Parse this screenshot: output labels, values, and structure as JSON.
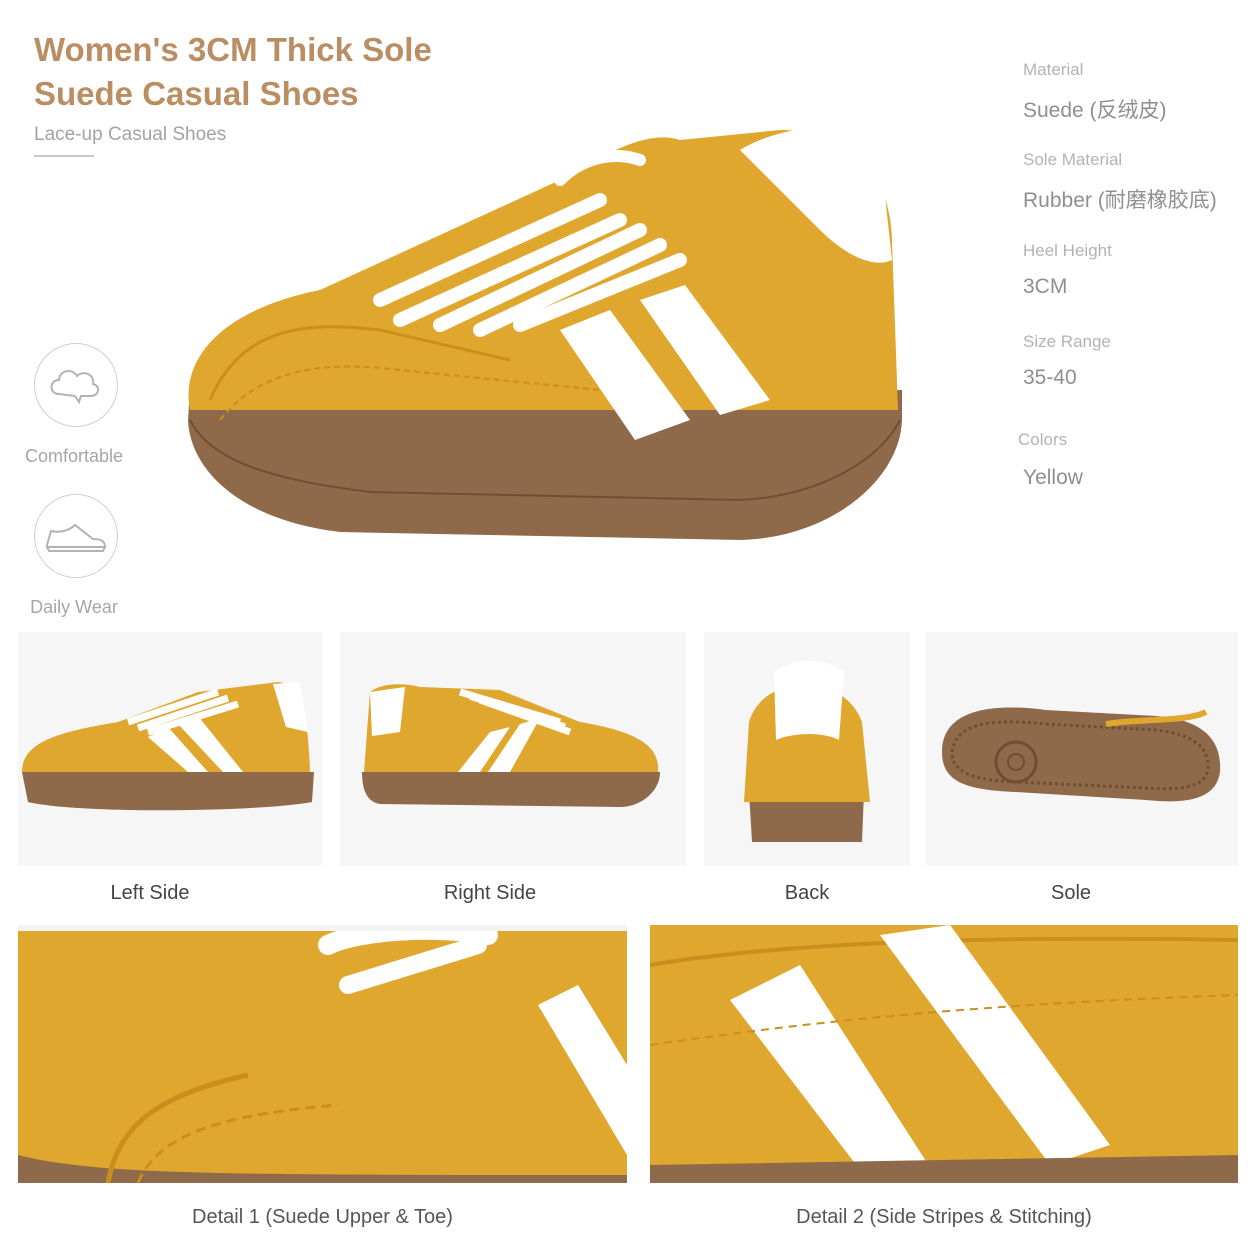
{
  "header": {
    "title_line1": "Women's 3CM Thick Sole",
    "title_line2": "Suede Casual Shoes",
    "subtitle": "Lace-up Casual Shoes"
  },
  "specs": [
    {
      "label": "Material",
      "value": "Suede (反绒皮)"
    },
    {
      "label": "Sole Material",
      "value": "Rubber (耐磨橡胶底)"
    },
    {
      "label": "Heel Height",
      "value": "3CM"
    },
    {
      "label": "Size Range",
      "value": "35-40"
    },
    {
      "label": "Colors",
      "value": "Yellow"
    }
  ],
  "features": [
    {
      "label": "Comfortable",
      "icon": "cloud-icon"
    },
    {
      "label": "Daily Wear",
      "icon": "sneaker-icon"
    }
  ],
  "views": [
    {
      "label": "Left Side"
    },
    {
      "label": "Right Side"
    },
    {
      "label": "Back"
    },
    {
      "label": "Sole"
    }
  ],
  "details": [
    {
      "label": "Detail 1 (Suede Upper & Toe)"
    },
    {
      "label": "Detail 2 (Side Stripes & Stitching)"
    }
  ],
  "colors": {
    "title": "#bb8d63",
    "suede": "#e0a72e",
    "suede_dark": "#c98e1c",
    "gum_sole": "#8f6a4a",
    "stripe": "#ffffff"
  }
}
